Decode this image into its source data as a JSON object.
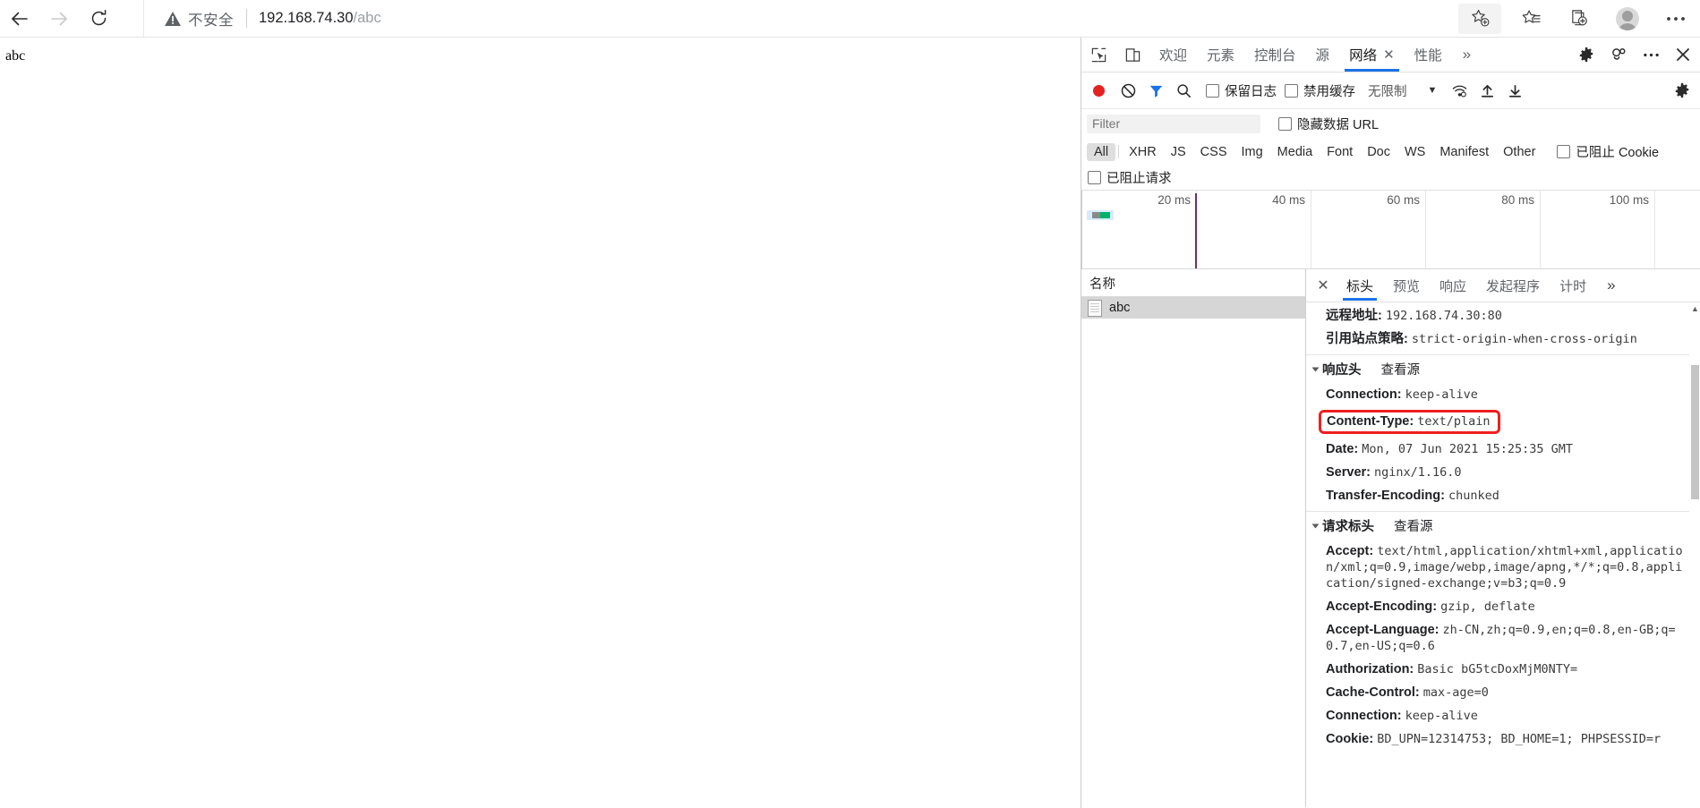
{
  "browser": {
    "back_label": "back-arrow",
    "forward_label": "forward-arrow",
    "reload_label": "reload",
    "security_label": "不安全",
    "url_main": "192.168.74.30",
    "url_path": "/abc",
    "icons": [
      "add-favorite-icon",
      "favorites-icon",
      "collections-icon",
      "profile-avatar",
      "more-icon"
    ]
  },
  "page": {
    "body_text": "abc"
  },
  "devtools": {
    "tool_icons": [
      "inspect-element-icon",
      "device-toolbar-icon"
    ],
    "tabs": [
      {
        "label": "欢迎",
        "active": false
      },
      {
        "label": "元素",
        "active": false
      },
      {
        "label": "控制台",
        "active": false
      },
      {
        "label": "源",
        "active": false
      },
      {
        "label": "网络",
        "active": true,
        "close": "✕"
      },
      {
        "label": "性能",
        "active": false
      }
    ],
    "more_tabs": "»",
    "right_icons": [
      "settings-gear-icon",
      "customize-icon",
      "more-options-icon",
      "close-devtools-icon"
    ],
    "network_toolbar": {
      "record_label": "record-button",
      "clear_label": "clear-button",
      "filter_label": "filter-button",
      "search_label": "search-button",
      "preserve_log": "保留日志",
      "disable_cache": "禁用缓存",
      "throttle_value": "无限制",
      "throttle_caret": "▼",
      "icons": [
        "network-conditions-icon",
        "upload-har-icon",
        "download-har-icon",
        "network-settings-gear-icon"
      ]
    },
    "filter_row": {
      "placeholder": "Filter",
      "value": "",
      "hide_data_urls": "隐藏数据 URL"
    },
    "type_filters": [
      {
        "label": "All",
        "selected": true
      },
      {
        "label": "XHR",
        "selected": false
      },
      {
        "label": "JS",
        "selected": false
      },
      {
        "label": "CSS",
        "selected": false
      },
      {
        "label": "Img",
        "selected": false
      },
      {
        "label": "Media",
        "selected": false
      },
      {
        "label": "Font",
        "selected": false
      },
      {
        "label": "Doc",
        "selected": false
      },
      {
        "label": "WS",
        "selected": false
      },
      {
        "label": "Manifest",
        "selected": false
      },
      {
        "label": "Other",
        "selected": false
      }
    ],
    "blocked_cookies": "已阻止 Cookie",
    "blocked_requests": "已阻止请求",
    "overview": {
      "tick_labels": [
        "20 ms",
        "40 ms",
        "60 ms",
        "80 ms",
        "100 ms"
      ],
      "bar_color": "#d6ecfb",
      "marker_color": "#6b2f6b"
    },
    "requests": {
      "column_header": "名称",
      "rows": [
        {
          "name": "abc",
          "selected": true
        }
      ]
    },
    "detail_tabs": [
      {
        "label": "标头",
        "active": true
      },
      {
        "label": "预览",
        "active": false
      },
      {
        "label": "响应",
        "active": false
      },
      {
        "label": "发起程序",
        "active": false
      },
      {
        "label": "计时",
        "active": false
      }
    ],
    "detail_close": "✕",
    "detail_more": "»",
    "headers": {
      "general_partial": [
        {
          "name": "远程地址:",
          "value": "192.168.74.30:80"
        },
        {
          "name": "引用站点策略:",
          "value": "strict-origin-when-cross-origin"
        }
      ],
      "response_section": {
        "title": "响应头",
        "view_source": "查看源"
      },
      "response_headers": [
        {
          "name": "Connection:",
          "value": "keep-alive",
          "highlight": false
        },
        {
          "name": "Content-Type:",
          "value": "text/plain",
          "highlight": true
        },
        {
          "name": "Date:",
          "value": "Mon, 07 Jun 2021 15:25:35 GMT",
          "highlight": false
        },
        {
          "name": "Server:",
          "value": "nginx/1.16.0",
          "highlight": false
        },
        {
          "name": "Transfer-Encoding:",
          "value": "chunked",
          "highlight": false
        }
      ],
      "request_section": {
        "title": "请求标头",
        "view_source": "查看源"
      },
      "request_headers": [
        {
          "name": "Accept:",
          "value": "text/html,application/xhtml+xml,application/xml;q=0.9,image/webp,image/apng,*/*;q=0.8,application/signed-exchange;v=b3;q=0.9",
          "wrap": true
        },
        {
          "name": "Accept-Encoding:",
          "value": "gzip, deflate",
          "wrap": false
        },
        {
          "name": "Accept-Language:",
          "value": "zh-CN,zh;q=0.9,en;q=0.8,en-GB;q=0.7,en-US;q=0.6",
          "wrap": true
        },
        {
          "name": "Authorization:",
          "value": "Basic bG5tcDoxMjM0NTY=",
          "wrap": false
        },
        {
          "name": "Cache-Control:",
          "value": "max-age=0",
          "wrap": false
        },
        {
          "name": "Connection:",
          "value": "keep-alive",
          "wrap": false
        },
        {
          "name": "Cookie:",
          "value": "BD_UPN=12314753; BD_HOME=1; PHPSESSID=r",
          "wrap": false
        }
      ]
    }
  }
}
